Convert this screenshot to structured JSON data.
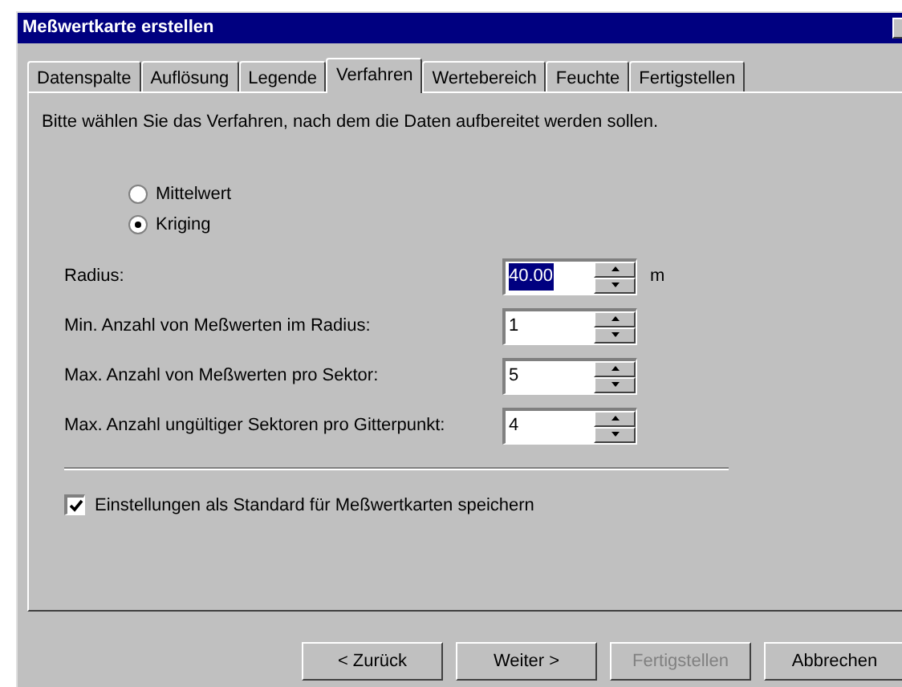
{
  "window": {
    "title": "Meßwertkarte erstellen"
  },
  "tabs": [
    {
      "label": "Datenspalte",
      "selected": false
    },
    {
      "label": "Auflösung",
      "selected": false
    },
    {
      "label": "Legende",
      "selected": false
    },
    {
      "label": "Verfahren",
      "selected": true
    },
    {
      "label": "Wertebereich",
      "selected": false
    },
    {
      "label": "Feuchte",
      "selected": false
    },
    {
      "label": "Fertigstellen",
      "selected": false
    }
  ],
  "instruction": "Bitte wählen Sie das Verfahren, nach dem die Daten aufbereitet werden sollen.",
  "methods": [
    {
      "label": "Mittelwert",
      "selected": false
    },
    {
      "label": "Kriging",
      "selected": true
    }
  ],
  "fields": [
    {
      "label": "Radius:",
      "value": "40.00",
      "text_selected": true,
      "unit": "m"
    },
    {
      "label": "Min. Anzahl von Meßwerten im Radius:",
      "value": "1",
      "text_selected": false
    },
    {
      "label": "Max. Anzahl von Meßwerten pro Sektor:",
      "value": "5",
      "text_selected": false
    },
    {
      "label": "Max. Anzahl ungültiger Sektoren pro Gitterpunkt:",
      "value": "4",
      "text_selected": false
    }
  ],
  "save_default": {
    "label": "Einstellungen als Standard für Meßwertkarten speichern",
    "checked": true
  },
  "buttons": [
    {
      "label": "< Zurück",
      "disabled": false
    },
    {
      "label": "Weiter >",
      "disabled": false
    },
    {
      "label": "Fertigstellen",
      "disabled": true
    },
    {
      "label": "Abbrechen",
      "disabled": false
    }
  ]
}
